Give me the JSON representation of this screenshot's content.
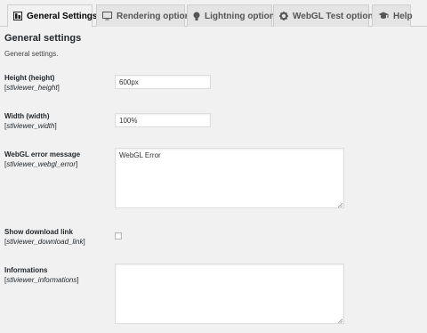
{
  "tabs": [
    {
      "label": "General Settings",
      "icon": "dashboard-icon",
      "active": true
    },
    {
      "label": "Rendering options",
      "icon": "monitor-icon",
      "active": false
    },
    {
      "label": "Lightning options",
      "icon": "lightbulb-icon",
      "active": false
    },
    {
      "label": "WebGL Test options",
      "icon": "gear-icon",
      "active": false
    },
    {
      "label": "Help",
      "icon": "mortarboard-icon",
      "active": false
    }
  ],
  "section": {
    "title": "General settings",
    "description": "General settings."
  },
  "fields": {
    "height": {
      "label": "Height (height)",
      "option": "stlviewer_height",
      "value": "600px"
    },
    "width": {
      "label": "Width (width)",
      "option": "stlviewer_width",
      "value": "100%"
    },
    "webgl_error": {
      "label": "WebGL error message",
      "option": "stlviewer_webgl_error",
      "value": "WebGL Error"
    },
    "download_link": {
      "label": "Show download link",
      "option": "stlviewer_download_link",
      "checked": false
    },
    "informations": {
      "label": "Informations",
      "option": "stlviewer_informations",
      "value": ""
    }
  }
}
